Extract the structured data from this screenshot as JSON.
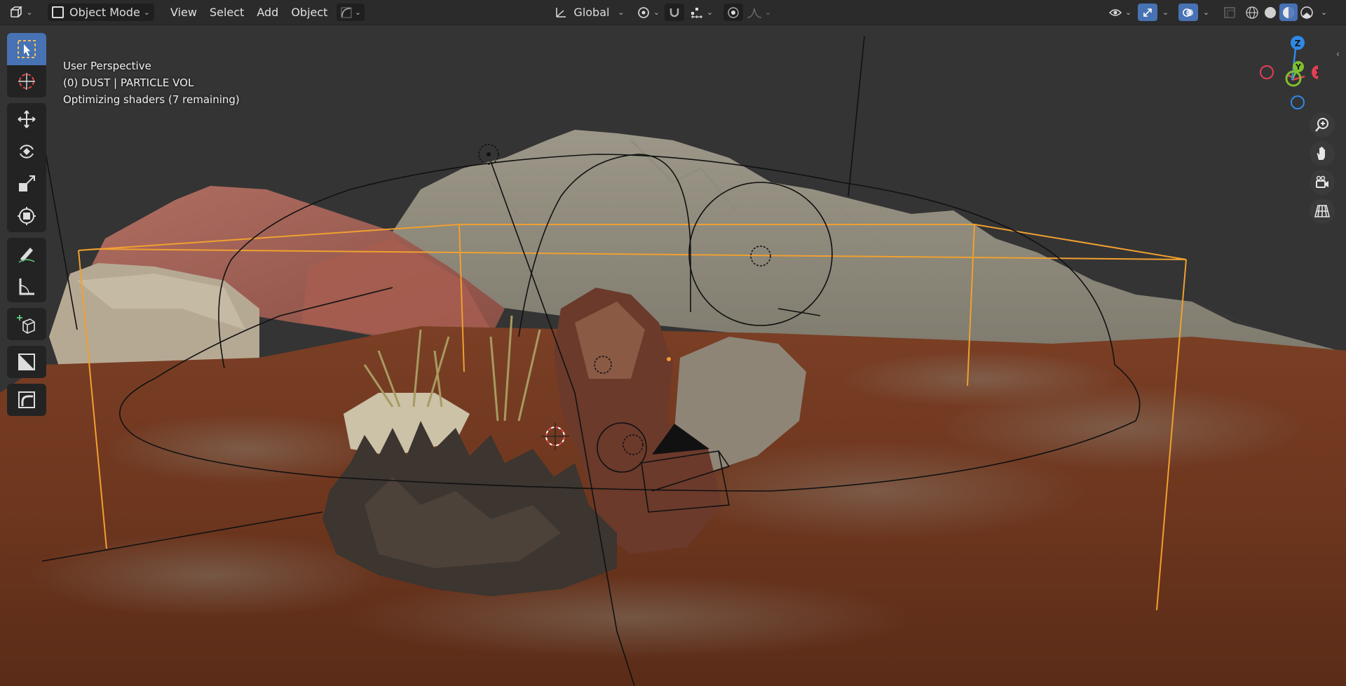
{
  "header": {
    "editor_type_icon": "viewport-editor-icon",
    "mode_label": "Object Mode",
    "menus": [
      "View",
      "Select",
      "Add",
      "Object"
    ],
    "transform_orientation": "Global"
  },
  "viewport": {
    "perspective_label": "User Perspective",
    "active_object_label": "(0) DUST | PARTICLE VOL",
    "status_label": "Optimizing shaders (7 remaining)"
  },
  "gizmo": {
    "axis_x": "X",
    "axis_y": "Y",
    "axis_z": "Z",
    "colors": {
      "x": "#e04055",
      "y": "#7fbf2d",
      "z": "#2e89e6"
    }
  },
  "toolbar": {
    "tools": [
      "select-box-icon",
      "cursor-icon",
      "move-icon",
      "rotate-icon",
      "scale-icon",
      "transform-icon",
      "annotate-icon",
      "measure-icon",
      "add-cube-icon",
      "shading-icon",
      "curve-icon"
    ],
    "active_tool": "select-box-icon"
  },
  "colors": {
    "accent": "#4772b3",
    "selection_outline": "#f0a030",
    "header_bg": "#2b2b2b"
  }
}
